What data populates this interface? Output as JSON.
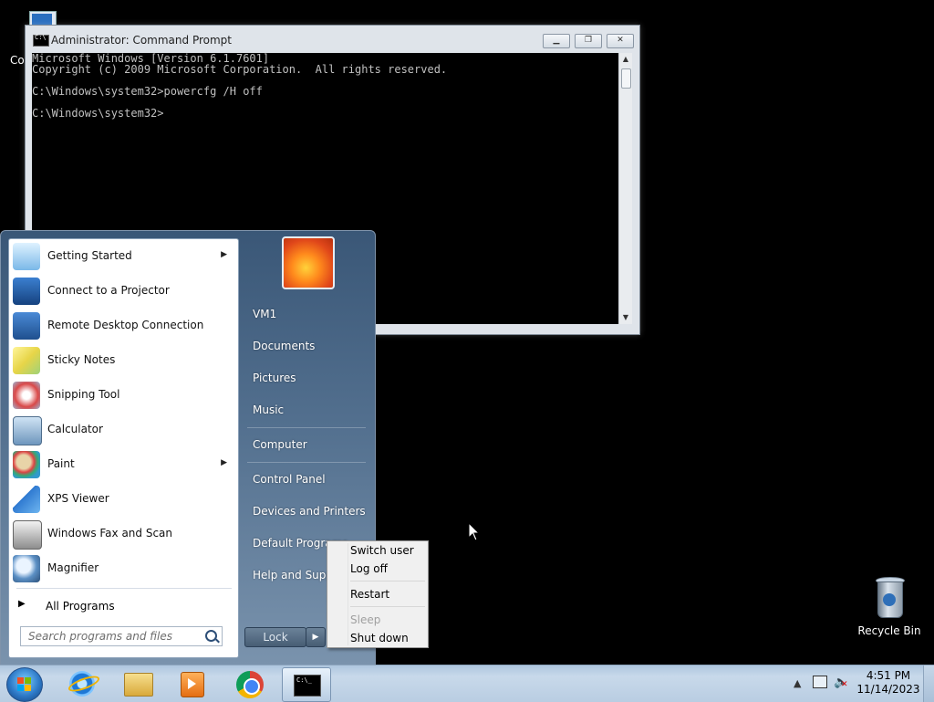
{
  "desktop": {
    "icons": [
      {
        "label": "Co",
        "icon": "computer-icon"
      },
      {
        "label": "Recycle Bin",
        "icon": "recycle-bin-icon"
      }
    ]
  },
  "cmd_window": {
    "title": "Administrator: Command Prompt",
    "lines": [
      "Microsoft Windows [Version 6.1.7601]",
      "Copyright (c) 2009 Microsoft Corporation.  All rights reserved.",
      "",
      "C:\\Windows\\system32>powercfg /H off",
      "",
      "C:\\Windows\\system32>"
    ],
    "controls": {
      "minimize": "minimize",
      "maximize": "maximize",
      "close": "close"
    }
  },
  "start_menu": {
    "programs": [
      {
        "label": "Getting Started",
        "icon": "getting-started-icon",
        "has_submenu": true
      },
      {
        "label": "Connect to a Projector",
        "icon": "projector-icon",
        "has_submenu": false
      },
      {
        "label": "Remote Desktop Connection",
        "icon": "remote-desktop-icon",
        "has_submenu": false
      },
      {
        "label": "Sticky Notes",
        "icon": "sticky-notes-icon",
        "has_submenu": false
      },
      {
        "label": "Snipping Tool",
        "icon": "snipping-tool-icon",
        "has_submenu": false
      },
      {
        "label": "Calculator",
        "icon": "calculator-icon",
        "has_submenu": false
      },
      {
        "label": "Paint",
        "icon": "paint-icon",
        "has_submenu": true
      },
      {
        "label": "XPS Viewer",
        "icon": "xps-viewer-icon",
        "has_submenu": false
      },
      {
        "label": "Windows Fax and Scan",
        "icon": "fax-scan-icon",
        "has_submenu": false
      },
      {
        "label": "Magnifier",
        "icon": "magnifier-icon",
        "has_submenu": false
      }
    ],
    "all_programs": "All Programs",
    "search_placeholder": "Search programs and files",
    "right_items": [
      "VM1",
      "Documents",
      "Pictures",
      "Music",
      "Computer",
      "Control Panel",
      "Devices and Printers",
      "Default Programs",
      "Help and Support"
    ],
    "lock_label": "Lock"
  },
  "power_menu": {
    "items": [
      {
        "label": "Switch user",
        "enabled": true
      },
      {
        "label": "Log off",
        "enabled": true
      },
      {
        "label": "Restart",
        "enabled": true
      },
      {
        "label": "Sleep",
        "enabled": false
      },
      {
        "label": "Shut down",
        "enabled": true
      }
    ]
  },
  "taskbar": {
    "pinned": [
      "internet-explorer-icon",
      "windows-explorer-icon",
      "media-player-icon",
      "chrome-icon",
      "command-prompt-icon"
    ],
    "active": "command-prompt-icon",
    "clock_time": "4:51 PM",
    "clock_date": "11/14/2023"
  },
  "colors": {
    "start_menu_top": "#3a5777",
    "taskbar": "#b9cde2",
    "cmd_background": "#000000",
    "cmd_text": "#c0c0c0"
  }
}
